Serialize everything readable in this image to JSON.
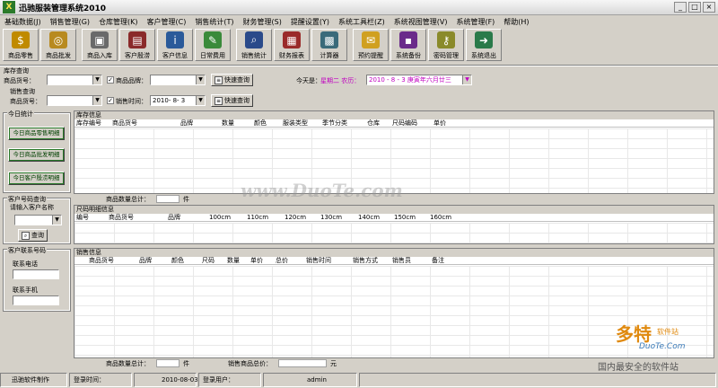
{
  "window": {
    "title": "迅驰服装管理系统2010",
    "icon_glyph": "X"
  },
  "menu": [
    "基础数据(J)",
    "销售管理(G)",
    "仓库管理(K)",
    "客户管理(C)",
    "销售统计(T)",
    "财务管理(S)",
    "提醒设置(Y)",
    "系统工具栏(Z)",
    "系统视图管理(V)",
    "系统管理(F)",
    "帮助(H)"
  ],
  "toolbar": [
    {
      "label": "商品零售",
      "icon": "cash-register-icon",
      "color": "#c08a00",
      "glyph": "$"
    },
    {
      "label": "商品批发",
      "icon": "coins-icon",
      "color": "#b88a20",
      "glyph": "◎"
    },
    {
      "label": "商品入库",
      "icon": "truck-icon",
      "color": "#6a6a6a",
      "glyph": "▣"
    },
    {
      "label": "客户殷涝",
      "icon": "book-icon",
      "color": "#8a2a2a",
      "glyph": "▤"
    },
    {
      "label": "客户信息",
      "icon": "info-icon",
      "color": "#2a5a9a",
      "glyph": "i"
    },
    {
      "label": "日常费用",
      "icon": "expense-icon",
      "color": "#3a8a3a",
      "glyph": "✎"
    },
    {
      "label": "销售统计",
      "icon": "magnifier-chart-icon",
      "color": "#2a4a8a",
      "glyph": "⌕"
    },
    {
      "label": "财务报表",
      "icon": "report-icon",
      "color": "#9a2a2a",
      "glyph": "▦"
    },
    {
      "label": "计算器",
      "icon": "calculator-icon",
      "color": "#3a6a7a",
      "glyph": "▩"
    },
    {
      "label": "预约提醒",
      "icon": "envelope-icon",
      "color": "#d0a020",
      "glyph": "✉"
    },
    {
      "label": "系统备份",
      "icon": "floppy-disk-icon",
      "color": "#6a2a8a",
      "glyph": "▪"
    },
    {
      "label": "密码管理",
      "icon": "key-icon",
      "color": "#8a8a2a",
      "glyph": "⚷"
    },
    {
      "label": "系统退出",
      "icon": "exit-door-icon",
      "color": "#2a7a4a",
      "glyph": "➜"
    }
  ],
  "query": {
    "inventory_section": "库存查询",
    "product_code_label": "商品货号：",
    "brand_label": "商品品牌：",
    "quick_query": "快速查询",
    "today_label": "今天是：",
    "today_value": "星期二 农历：",
    "date_value": "2010 - 8 - 3  庚寅年六月廿三",
    "sales_section": "销售查询",
    "sales_code_label": "商品货号：",
    "sales_time_label": "销售时间：",
    "sales_time_value": "2010- 8- 3",
    "sales_quick_query": "快速查询",
    "brand_checked": "✓",
    "time_checked": "✓"
  },
  "left": {
    "today_stats": "今日统计",
    "btn_retail": "今日商品零售明细",
    "btn_wholesale": "今日商品批发明细",
    "btn_customer": "今日客户殷涝明细",
    "customer_query": "客户号码查询",
    "enter_name": "请输入客户名称",
    "query_btn": "查询",
    "contact_section": "客户联系号码",
    "phone_label": "联系电话",
    "mobile_label": "联系手机"
  },
  "inventory": {
    "title": "库存信息",
    "columns": [
      "库存编号",
      "商品货号",
      "品牌",
      "数量",
      "颜色",
      "服装类型",
      "季节分类",
      "仓库",
      "尺码编码",
      "单价"
    ],
    "sum_label": "商品数量总计：",
    "sum_unit": "件"
  },
  "sizes": {
    "title": "尺码明细信息",
    "columns": [
      "编号",
      "商品货号",
      "品牌",
      "100cm",
      "110cm",
      "120cm",
      "130cm",
      "140cm",
      "150cm",
      "160cm"
    ]
  },
  "sales": {
    "title": "销售信息",
    "columns": [
      "商品货号",
      "品牌",
      "颜色",
      "尺码",
      "数量",
      "单价",
      "总价",
      "销售时间",
      "销售方式",
      "销售员",
      "备注"
    ],
    "sum_label": "商品数量总计：",
    "sum_unit": "件",
    "total_label": "销售商品总价：",
    "total_unit": "元"
  },
  "status": {
    "company": "迅驰软件制作",
    "login_time_label": "登录时间：",
    "login_time": "2010-08-03",
    "login_user_label": "登录用户：",
    "login_user": "admin"
  },
  "watermarks": {
    "center": "www.DuoTe.com",
    "brand_cn": "多特",
    "brand_suffix": "软件站",
    "brand_url": "DuoTe.Com",
    "slogan": "国内最安全的软件站"
  }
}
